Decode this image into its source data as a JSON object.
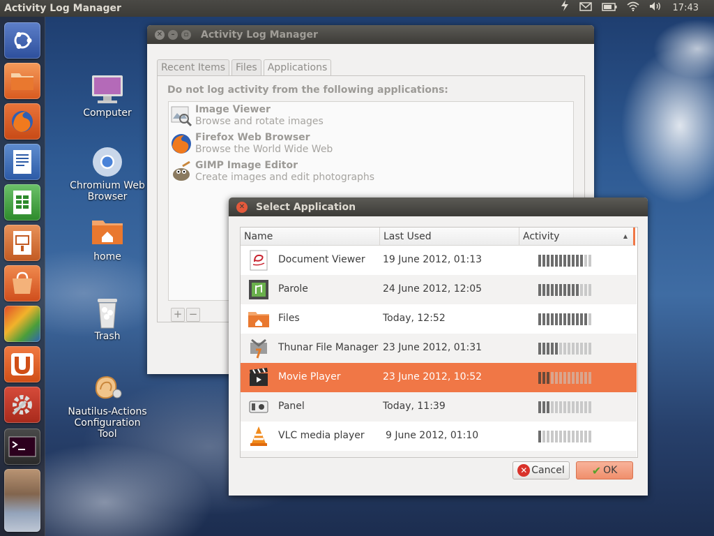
{
  "topbar": {
    "title": "Activity Log Manager",
    "clock": "17:43",
    "indicators": [
      "power-icon",
      "mail-icon",
      "battery-icon",
      "wifi-icon",
      "volume-icon"
    ]
  },
  "launcher": {
    "items": [
      "ubuntu-dash-icon",
      "files-icon",
      "firefox-icon",
      "writer-icon",
      "calc-icon",
      "impress-icon",
      "software-center-icon",
      "workspaces-icon",
      "ubuntu-one-icon",
      "system-settings-icon",
      "terminal-icon",
      "stacked-apps-icon"
    ]
  },
  "desktop": {
    "icons": [
      {
        "label": "Computer"
      },
      {
        "label": "Chromium Web Browser"
      },
      {
        "label": "home"
      },
      {
        "label": "Trash"
      },
      {
        "label": "Nautilus-Actions Configuration Tool"
      }
    ]
  },
  "alm": {
    "title": "Activity Log Manager",
    "tabs": [
      "Recent Items",
      "Files",
      "Applications"
    ],
    "active_tab": "Applications",
    "heading": "Do not log activity from the following applications:",
    "excluded": [
      {
        "name": "Image Viewer",
        "desc": "Browse and rotate images",
        "icon": "image-viewer-icon"
      },
      {
        "name": "Firefox Web Browser",
        "desc": "Browse the World Wide Web",
        "icon": "firefox-icon"
      },
      {
        "name": "GIMP Image Editor",
        "desc": "Create images and edit photographs",
        "icon": "gimp-icon"
      }
    ],
    "add_label": "+",
    "remove_label": "−"
  },
  "select_app": {
    "title": "Select Application",
    "columns": {
      "name": "Name",
      "last_used": "Last Used",
      "activity": "Activity",
      "sort_indicator": "▲"
    },
    "rows": [
      {
        "name": "Document Viewer",
        "last_used": "19 June 2012, 01:13",
        "activity": 0.85,
        "icon": "document-viewer-icon"
      },
      {
        "name": "Parole",
        "last_used": "24 June 2012, 12:05",
        "activity": 0.75,
        "icon": "parole-icon"
      },
      {
        "name": "Files",
        "last_used": "Today, 12:52",
        "activity": 0.95,
        "icon": "files-icon"
      },
      {
        "name": "Thunar File Manager",
        "last_used": "23 June 2012, 01:31",
        "activity": 0.35,
        "icon": "thunar-icon"
      },
      {
        "name": "Movie Player",
        "last_used": "23 June 2012, 10:52",
        "activity": 0.2,
        "icon": "movie-player-icon"
      },
      {
        "name": "Panel",
        "last_used": "Today, 11:39",
        "activity": 0.2,
        "icon": "panel-icon"
      },
      {
        "name": "VLC media player",
        "last_used": "9 June 2012, 01:10",
        "activity": 0.1,
        "icon": "vlc-icon"
      }
    ],
    "selected_row": 4,
    "cancel_label": "Cancel",
    "ok_label": "OK"
  }
}
